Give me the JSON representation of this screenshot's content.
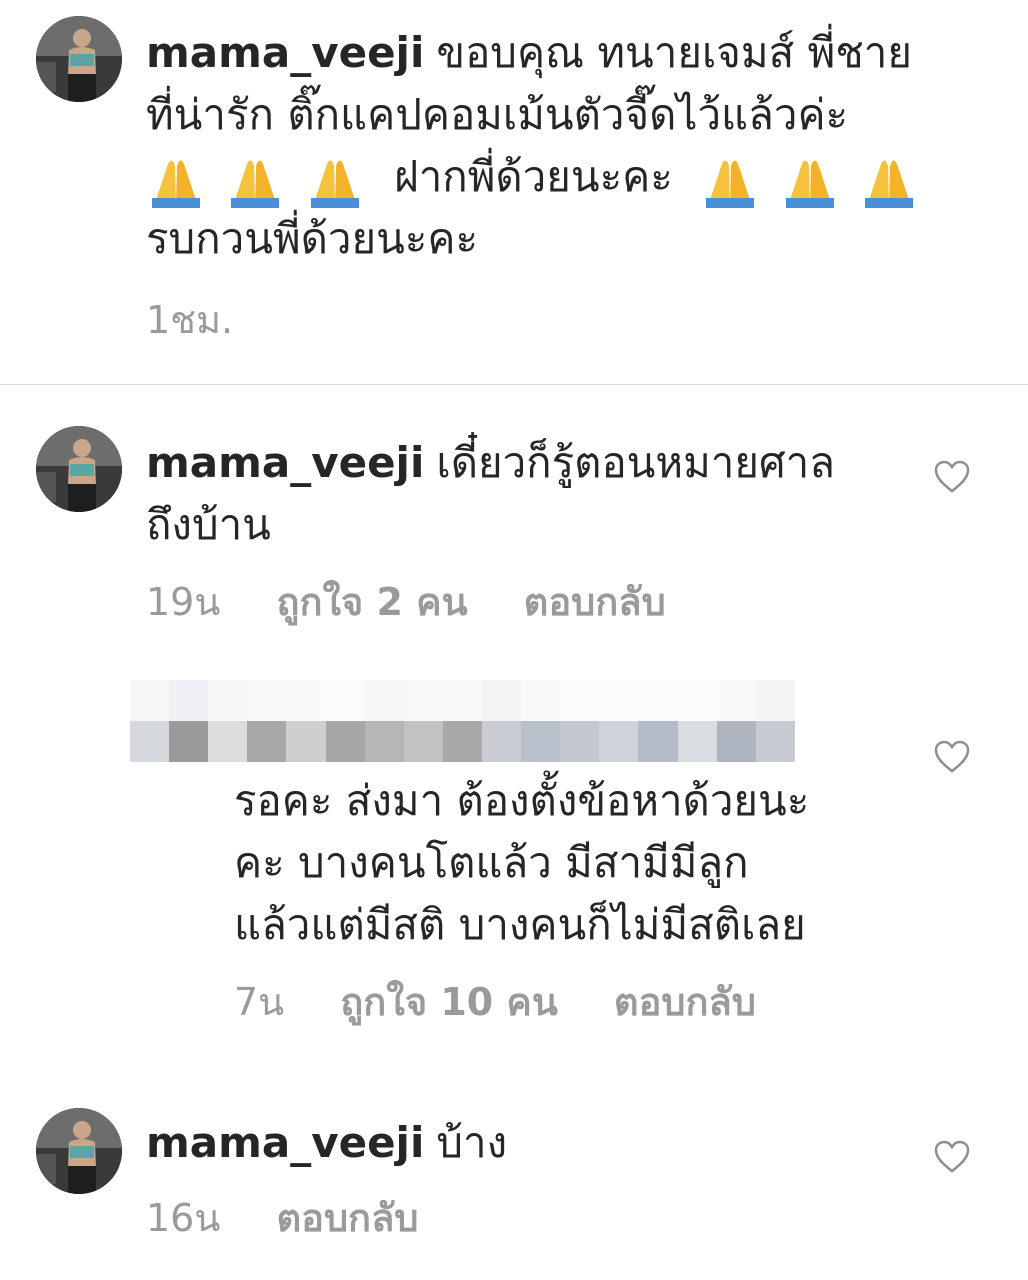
{
  "comments": [
    {
      "username": "mama_veeji",
      "lines": [
        "ขอบคุณ ทนายเจมส์  พี่ชาย",
        "ที่น่ารัก ติ๊กแคปคอมเม้นตัวจี๊ดไว้แล้วค่ะ"
      ],
      "line3_text": "ฝากพี่ด้วยนะคะ",
      "line4": "รบกวนพี่ด้วยนะคะ",
      "time": "1ชม."
    },
    {
      "username": "mama_veeji",
      "lines": [
        "เดี๋ยวก็รู้ตอนหมายศาล",
        "ถึงบ้าน"
      ],
      "time": "19น",
      "likes": "ถูกใจ 2 คน",
      "reply": "ตอบกลับ"
    },
    {
      "lines": [
        "รอคะ ส่งมา ต้องตั้งข้อหาด้วยนะ",
        "คะ  บางคนโตแล้ว มีสามีมีลูก",
        "แล้วแต่มีสติ บางคนก็ไม่มีสติเลย"
      ],
      "time": "7น",
      "likes": "ถูกใจ 10 คน",
      "reply": "ตอบกลับ"
    },
    {
      "username": "mama_veeji",
      "text": "บ้าง",
      "time": "16น",
      "reply": "ตอบกลับ"
    }
  ],
  "icons": {
    "pray": "folded-hands-emoji",
    "like": "heart-outline-icon"
  },
  "colors": {
    "text": "#262626",
    "meta": "#9a9a9a",
    "divider": "#dbdbdb"
  }
}
